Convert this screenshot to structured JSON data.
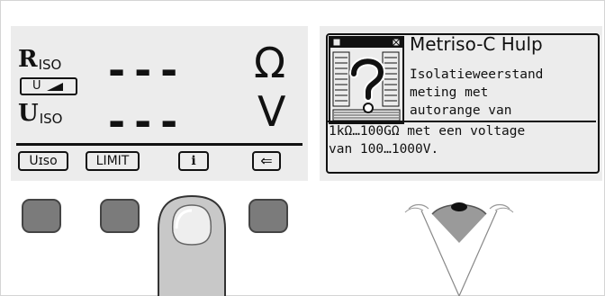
{
  "lcd_left": {
    "r_symbol": "R",
    "r_subscript": "ISO",
    "u_symbol": "U",
    "u_subscript": "ISO",
    "r_value": "---",
    "u_value": "---",
    "r_unit": "Ω",
    "u_unit": "V",
    "range_indicator": "U",
    "softkeys": {
      "k1": "Uɪso",
      "k2": "LIMIT",
      "k3": "i",
      "k4": "⇐"
    }
  },
  "lcd_right": {
    "title": "Metriso-C Hulp",
    "lines": [
      "Isolatieweerstand",
      "meting met",
      "autorange van",
      "1kΩ…100GΩ met een voltage",
      "van 100…1000V."
    ]
  },
  "icons": {
    "help": "help-book-question-icon",
    "finger": "finger-press-icon",
    "eye": "eye-view-icon"
  }
}
